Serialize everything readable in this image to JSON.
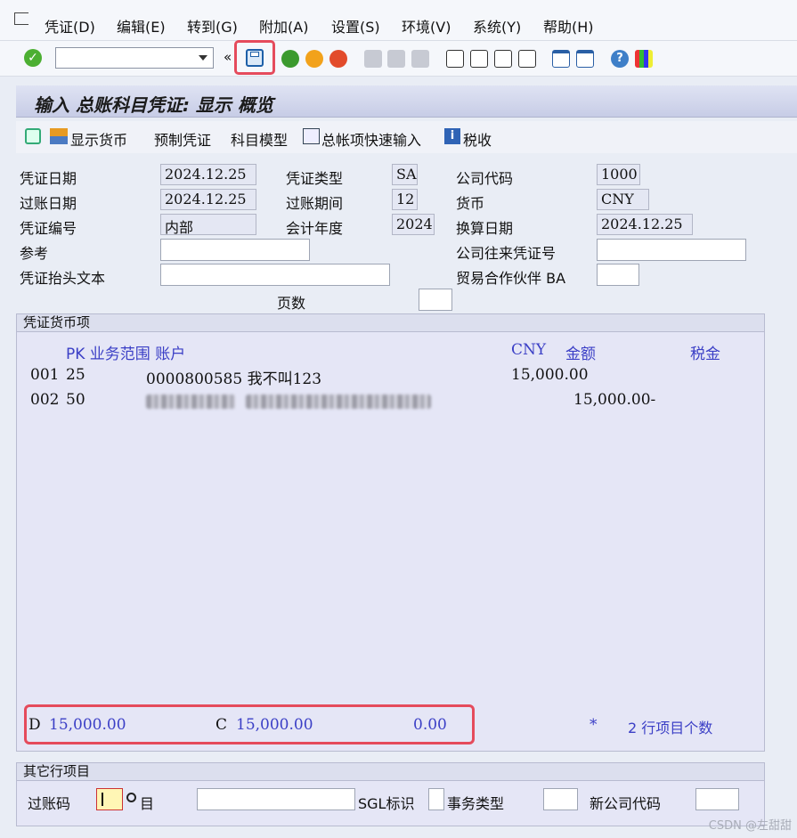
{
  "menu": {
    "items": [
      "凭证(D)",
      "编辑(E)",
      "转到(G)",
      "附加(A)",
      "设置(S)",
      "环境(V)",
      "系统(Y)",
      "帮助(H)"
    ]
  },
  "toolbar": {
    "command_value": "",
    "icons": [
      "check-icon",
      "save-icon",
      "back-icon",
      "exit-icon",
      "cancel-icon",
      "print-icon",
      "find-icon",
      "find-next-icon",
      "first-page-icon",
      "prev-page-icon",
      "next-page-icon",
      "last-page-icon",
      "new-session-icon",
      "shortcut-icon",
      "help-icon",
      "layout-icon"
    ]
  },
  "title": "输入 总账科目凭证: 显示 概览",
  "app_toolbar": {
    "show_currency": "显示货币",
    "park_doc": "预制凭证",
    "acct_model": "科目模型",
    "fast_entry": "总帐项快速输入",
    "tax": "税收"
  },
  "header": {
    "doc_date_label": "凭证日期",
    "doc_date": "2024.12.25",
    "doc_type_label": "凭证类型",
    "doc_type": "SA",
    "company_code_label": "公司代码",
    "company_code": "1000",
    "posting_date_label": "过账日期",
    "posting_date": "2024.12.25",
    "period_label": "过账期间",
    "period": "12",
    "currency_label": "货币",
    "currency": "CNY",
    "doc_no_label": "凭证编号",
    "doc_no": "内部",
    "fiscal_year_label": "会计年度",
    "fiscal_year": "2024",
    "translation_date_label": "换算日期",
    "translation_date": "2024.12.25",
    "reference_label": "参考",
    "reference": "",
    "intercompany_label": "公司往来凭证号",
    "header_text_label": "凭证抬头文本",
    "trading_partner_label": "贸易合作伙伴 BA",
    "pages_label": "页数"
  },
  "items_group": {
    "title": "凭证货币项",
    "columns": {
      "pk_area_acct": "PK 业务范围 账户",
      "currency": "CNY",
      "amount": "金额",
      "tax": "税金"
    },
    "rows": [
      {
        "line": "001",
        "pk": "25",
        "account": "0000800585 我不叫123",
        "debit": "15,000.00",
        "credit": ""
      },
      {
        "line": "002",
        "pk": "50",
        "account": "",
        "debit": "",
        "credit": "15,000.00-"
      }
    ],
    "totals": {
      "d_label": "D",
      "d_value": "15,000.00",
      "c_label": "C",
      "c_value": "15,000.00",
      "balance": "0.00",
      "star": "*",
      "line_count": "2 行项目个数"
    }
  },
  "other_group": {
    "title": "其它行项目",
    "posting_key_label": "过账码",
    "account_label": "目",
    "sgl_label": "SGL标识",
    "trans_type_label": "事务类型",
    "new_company_label": "新公司代码"
  },
  "watermark": "CSDN @左甜甜"
}
